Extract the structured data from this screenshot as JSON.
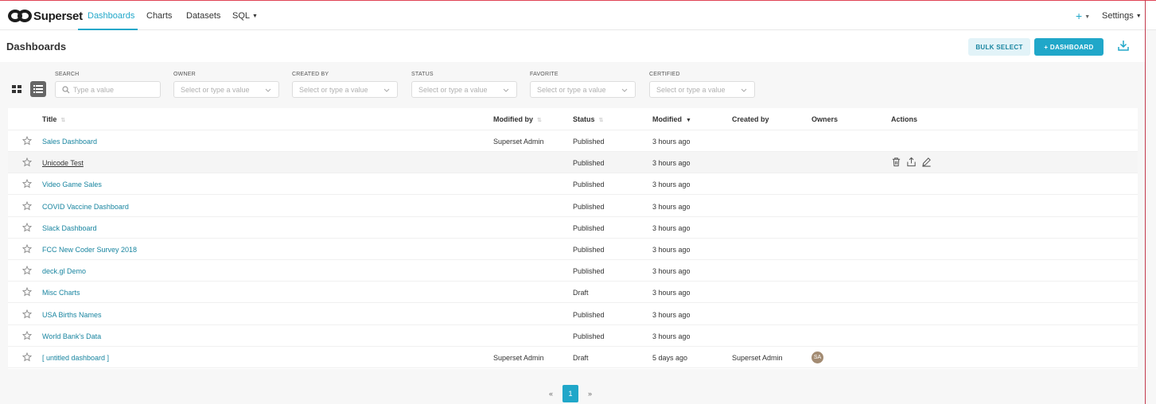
{
  "navbar": {
    "brand": "Superset",
    "items": [
      {
        "label": "Dashboards",
        "active": true
      },
      {
        "label": "Charts"
      },
      {
        "label": "Datasets"
      },
      {
        "label": "SQL"
      }
    ],
    "plus_label": "+",
    "settings_label": "Settings"
  },
  "header": {
    "title": "Dashboards",
    "bulk_select_label": "BULK SELECT",
    "add_dashboard_label": "+ DASHBOARD"
  },
  "filters": {
    "search": {
      "label": "SEARCH",
      "placeholder": "Type a value"
    },
    "owner": {
      "label": "OWNER",
      "placeholder": "Select or type a value"
    },
    "created_by": {
      "label": "CREATED BY",
      "placeholder": "Select or type a value"
    },
    "status": {
      "label": "STATUS",
      "placeholder": "Select or type a value"
    },
    "favorite": {
      "label": "FAVORITE",
      "placeholder": "Select or type a value"
    },
    "certified": {
      "label": "CERTIFIED",
      "placeholder": "Select or type a value"
    }
  },
  "table": {
    "columns": [
      "Title",
      "Modified by",
      "Status",
      "Modified",
      "Created by",
      "Owners",
      "Actions"
    ],
    "rows": [
      {
        "title": "Sales Dashboard",
        "modified_by": "Superset Admin",
        "status": "Published",
        "modified": "3 hours ago",
        "created_by": "",
        "owner": ""
      },
      {
        "title": "Unicode Test",
        "modified_by": "",
        "status": "Published",
        "modified": "3 hours ago",
        "created_by": "",
        "owner": ""
      },
      {
        "title": "Video Game Sales",
        "modified_by": "",
        "status": "Published",
        "modified": "3 hours ago",
        "created_by": "",
        "owner": ""
      },
      {
        "title": "COVID Vaccine Dashboard",
        "modified_by": "",
        "status": "Published",
        "modified": "3 hours ago",
        "created_by": "",
        "owner": ""
      },
      {
        "title": "Slack Dashboard",
        "modified_by": "",
        "status": "Published",
        "modified": "3 hours ago",
        "created_by": "",
        "owner": ""
      },
      {
        "title": "FCC New Coder Survey 2018",
        "modified_by": "",
        "status": "Published",
        "modified": "3 hours ago",
        "created_by": "",
        "owner": ""
      },
      {
        "title": "deck.gl Demo",
        "modified_by": "",
        "status": "Published",
        "modified": "3 hours ago",
        "created_by": "",
        "owner": ""
      },
      {
        "title": "Misc Charts",
        "modified_by": "",
        "status": "Draft",
        "modified": "3 hours ago",
        "created_by": "",
        "owner": ""
      },
      {
        "title": "USA Births Names",
        "modified_by": "",
        "status": "Published",
        "modified": "3 hours ago",
        "created_by": "",
        "owner": ""
      },
      {
        "title": "World Bank's Data",
        "modified_by": "",
        "status": "Published",
        "modified": "3 hours ago",
        "created_by": "",
        "owner": ""
      },
      {
        "title": "[ untitled dashboard ]",
        "modified_by": "Superset Admin",
        "status": "Draft",
        "modified": "5 days ago",
        "created_by": "Superset Admin",
        "owner": "SA"
      }
    ]
  },
  "pagination": {
    "prev": "«",
    "current": "1",
    "next": "»"
  },
  "colors": {
    "accent": "#20a7c9",
    "link": "#1985a0",
    "avatar": "#a38b72"
  }
}
